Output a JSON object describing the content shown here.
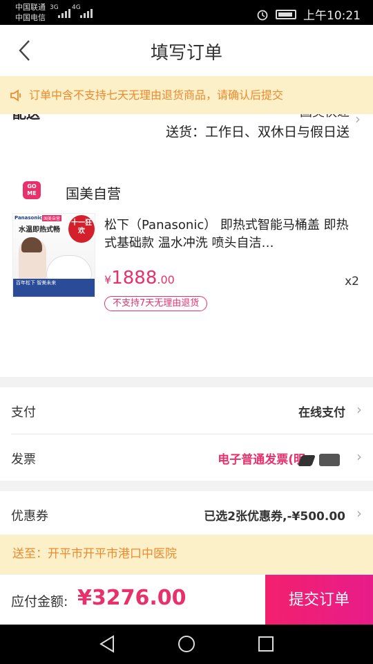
{
  "status_bar": {
    "carrier1": "中国联通",
    "carrier2": "中国电信",
    "net1": "3G",
    "net2": "4G",
    "time": "上午10:21"
  },
  "header": {
    "title": "填写订单"
  },
  "notice": {
    "text": "订单中含不支持七天无理由退货商品，请确认后提交"
  },
  "delivery": {
    "label_clipped": "配送",
    "method_clipped": "国美快递",
    "time": "送货：工作日、双休日与假日送"
  },
  "store": {
    "icon_text": "GO ME",
    "name": "国美自营"
  },
  "product": {
    "image_text": {
      "brand": "Panasonic",
      "tag": "国美自营",
      "headline": "水温即热式畅",
      "badge": "十一狂欢",
      "strip": "百年松下 智美未来"
    },
    "name": "松下（Panasonic） 即热式智能马桶盖 即热式基础款 温水冲洗 喷头自洁…",
    "price_symbol": "¥",
    "price_int": "1888",
    "price_dec": ".00",
    "quantity": "x2",
    "return_badge": "不支持7天无理由退货"
  },
  "payment": {
    "label": "支付",
    "value": "在线支付"
  },
  "invoice": {
    "label": "发票",
    "value": "电子普通发票(明"
  },
  "coupon": {
    "label": "优惠券",
    "value": "已选2张优惠券,-¥500.00"
  },
  "address": {
    "text": "送至：开平市开平市港口中医院"
  },
  "footer": {
    "total_label": "应付金额:",
    "total": "¥3276.00",
    "submit": "提交订单"
  },
  "colors": {
    "accent": "#e8316a",
    "notice_bg": "#fbf0c8",
    "notice_text": "#ee8a2e"
  }
}
